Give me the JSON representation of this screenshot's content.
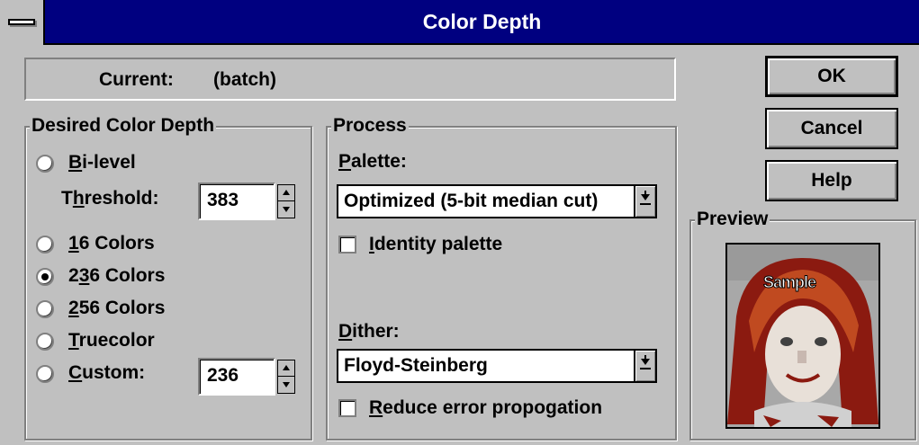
{
  "window": {
    "title": "Color Depth"
  },
  "current": {
    "label": "Current:",
    "value": "(batch)"
  },
  "desired": {
    "legend": "Desired Color Depth",
    "bilevel": {
      "pre": "",
      "key": "B",
      "post": "i-level",
      "checked": false
    },
    "threshold": {
      "pre": "T",
      "key": "h",
      "post": "reshold:",
      "value": "383"
    },
    "c16": {
      "pre": "",
      "key": "1",
      "post": "6 Colors",
      "checked": false
    },
    "c236": {
      "pre": "2",
      "key": "3",
      "post": "6 Colors",
      "checked": true
    },
    "c256": {
      "pre": "",
      "key": "2",
      "post": "56 Colors",
      "checked": false
    },
    "truecolor": {
      "pre": "",
      "key": "T",
      "post": "ruecolor",
      "checked": false
    },
    "custom": {
      "pre": "",
      "key": "C",
      "post": "ustom:",
      "checked": false,
      "value": "236"
    }
  },
  "process": {
    "legend": "Process",
    "palette_label": {
      "pre": "",
      "key": "P",
      "post": "alette:"
    },
    "palette_value": "Optimized (5-bit median cut)",
    "identity": {
      "pre": "",
      "key": "I",
      "post": "dentity palette",
      "checked": false
    },
    "dither_label": {
      "pre": "",
      "key": "D",
      "post": "ither:"
    },
    "dither_value": "Floyd-Steinberg",
    "reduce": {
      "pre": "",
      "key": "R",
      "post": "educe error propogation",
      "checked": false
    }
  },
  "buttons": {
    "ok": "OK",
    "cancel": "Cancel",
    "help": "Help"
  },
  "preview": {
    "legend": "Preview",
    "sample_text": "Sample"
  },
  "icons": {
    "system_menu": "system-menu-icon",
    "spinner": "spinner-arrows-icon",
    "dropdown": "dropdown-arrow-icon"
  }
}
